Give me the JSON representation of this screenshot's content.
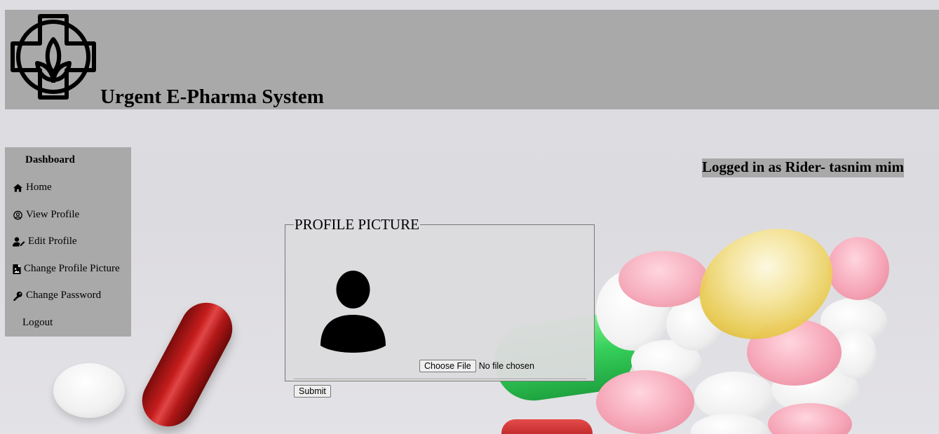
{
  "header": {
    "title": "Urgent E-Pharma System",
    "logo_icon": "pharmacy-cross-leaf-icon"
  },
  "sidebar": {
    "heading": "Dashboard",
    "items": [
      {
        "label": "Home",
        "icon": "home-icon"
      },
      {
        "label": "View Profile",
        "icon": "user-circle-icon"
      },
      {
        "label": "Edit Profile",
        "icon": "user-edit-icon"
      },
      {
        "label": "Change Profile Picture",
        "icon": "file-image-icon"
      },
      {
        "label": "Change Password",
        "icon": "key-icon"
      },
      {
        "label": "Logout",
        "icon": ""
      }
    ]
  },
  "status": {
    "logged_in": "Logged in as Rider- tasnim mim"
  },
  "form": {
    "legend": "PROFILE PICTURE",
    "choose_file_label": "Choose File",
    "file_status": "No file chosen",
    "submit_label": "Submit"
  },
  "colors": {
    "header_bg": "#a9a9a9",
    "page_bg": "#dcdbe0"
  }
}
